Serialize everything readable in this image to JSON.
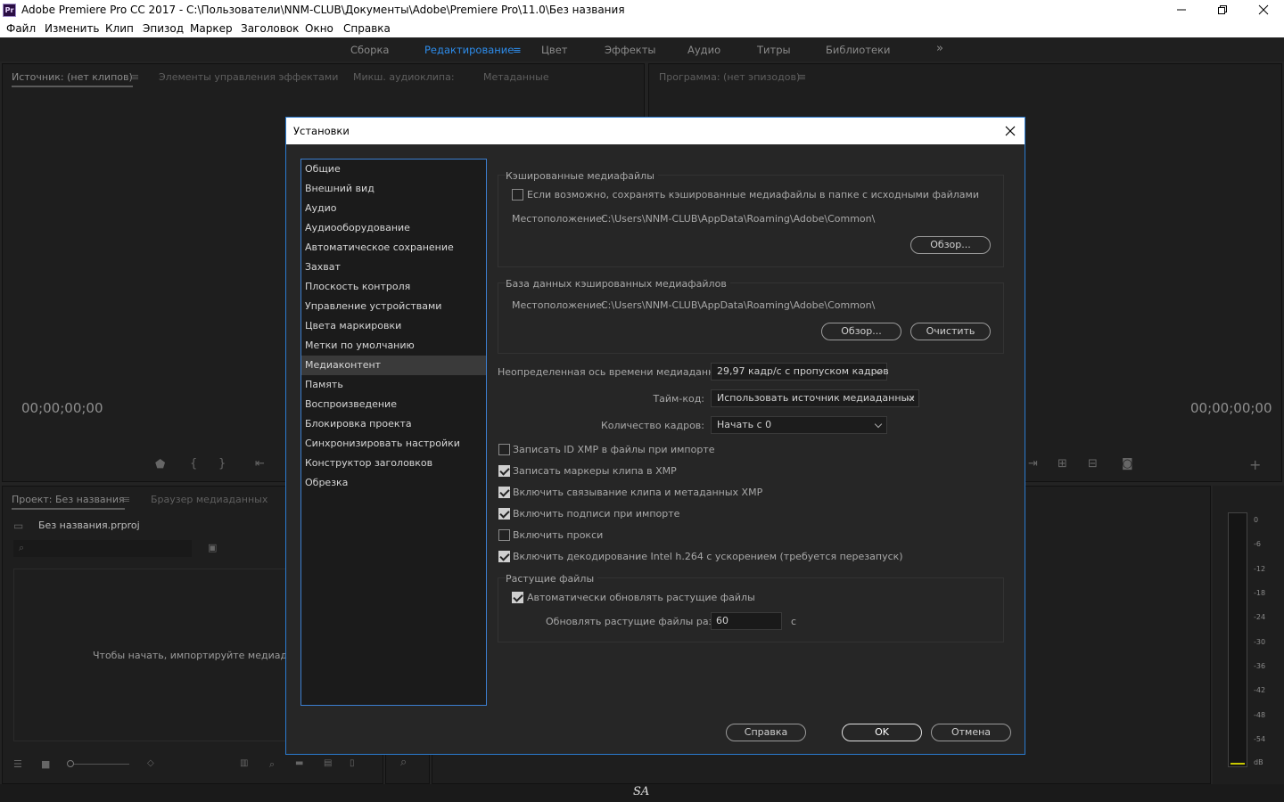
{
  "window": {
    "title": "Adobe Premiere Pro CC 2017 - C:\\Пользователи\\NNM-CLUB\\Документы\\Adobe\\Premiere Pro\\11.0\\Без названия",
    "app_icon": "Pr"
  },
  "menu": [
    "Файл",
    "Изменить",
    "Клип",
    "Эпизод",
    "Маркер",
    "Заголовок",
    "Окно",
    "Справка"
  ],
  "workspaces": {
    "items": [
      "Сборка",
      "Редактирование",
      "Цвет",
      "Эффекты",
      "Аудио",
      "Титры",
      "Библиотеки"
    ],
    "active": "Редактирование",
    "overflow": "»"
  },
  "source_panel": {
    "tabs": [
      "Источник: (нет клипов)",
      "Элементы управления эффектами",
      "Микш. аудиоклипа:",
      "Метаданные"
    ],
    "timecode": "00;00;00;00"
  },
  "program_panel": {
    "tab": "Программа: (нет эпизодов)",
    "timecode": "00;00;00;00"
  },
  "project_panel": {
    "tabs": [
      "Проект: Без названия",
      "Браузер медиаданных"
    ],
    "file": "Без названия.prproj",
    "hint": "Чтобы начать, импортируйте медиаданны"
  },
  "meter": {
    "scale": [
      "0",
      "-6",
      "-12",
      "-18",
      "-24",
      "-30",
      "-36",
      "-42",
      "-48",
      "-54",
      "dB"
    ]
  },
  "dialog": {
    "title": "Установки",
    "categories": [
      "Общие",
      "Внешний вид",
      "Аудио",
      "Аудиооборудование",
      "Автоматическое сохранение",
      "Захват",
      "Плоскость контроля",
      "Управление устройствами",
      "Цвета маркировки",
      "Метки по умолчанию",
      "Медиаконтент",
      "Память",
      "Воспроизведение",
      "Блокировка проекта",
      "Синхронизировать настройки",
      "Конструктор заголовков",
      "Обрезка"
    ],
    "selected_category": "Медиаконтент",
    "cache": {
      "label": "Кэшированные медиафайлы",
      "save_next_to_source": "Если возможно, сохранять кэшированные медиафайлы в папке с исходными файлами",
      "save_next_to_source_checked": false,
      "location_label": "Местоположение:",
      "location": "C:\\Users\\NNM-CLUB\\AppData\\Roaming\\Adobe\\Common\\",
      "browse": "Обзор..."
    },
    "cache_db": {
      "label": "База данных кэшированных медиафайлов",
      "location_label": "Местоположение:",
      "location": "C:\\Users\\NNM-CLUB\\AppData\\Roaming\\Adobe\\Common\\",
      "browse": "Обзор...",
      "clean": "Очистить"
    },
    "indeterminate_timebase_label": "Неопределенная ось времени медиаданных:",
    "indeterminate_timebase": "29,97 кадр/с с пропуском кадров",
    "timecode_label": "Тайм-код:",
    "timecode": "Использовать источник медиаданных",
    "frame_count_label": "Количество кадров:",
    "frame_count": "Начать с 0",
    "options": [
      {
        "label": "Записать ID XMP в файлы при импорте",
        "checked": false
      },
      {
        "label": "Записать маркеры клипа в XMP",
        "checked": true
      },
      {
        "label": "Включить связывание клипа и метаданных XMP",
        "checked": true
      },
      {
        "label": "Включить подписи при импорте",
        "checked": true
      },
      {
        "label": "Включить прокси",
        "checked": false
      },
      {
        "label": "Включить декодирование Intel h.264 с ускорением (требуется перезапуск)",
        "checked": true
      }
    ],
    "growing": {
      "label": "Растущие файлы",
      "auto_refresh": "Автоматически обновлять растущие файлы",
      "auto_refresh_checked": true,
      "interval_label": "Обновлять растущие файлы раз в",
      "interval": "60",
      "unit": "с"
    },
    "buttons": {
      "help": "Справка",
      "ok": "OK",
      "cancel": "Отмена"
    }
  },
  "status": {
    "signature": "SA"
  }
}
